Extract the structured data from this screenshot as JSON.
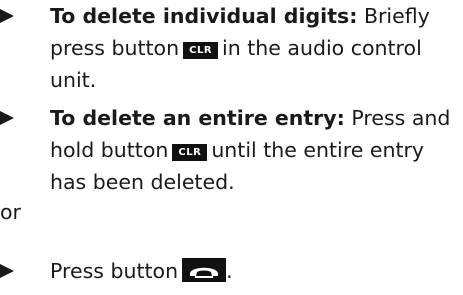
{
  "items": [
    {
      "bold": "To delete individual digits:",
      "line1_rest": " Briefly",
      "line2_pre": "press button",
      "key": "CLR",
      "line2_post": "in the audio control",
      "line3": "unit."
    },
    {
      "bold": "To delete an entire entry:",
      "line1_rest": " Press and",
      "line2_pre": "hold button",
      "key": "CLR",
      "line2_post": "until the entire entry",
      "line3": "has been deleted."
    }
  ],
  "or_text": "or",
  "last_item": {
    "pre": "Press button",
    "post": ".",
    "icon": "hang-up-phone-icon"
  }
}
